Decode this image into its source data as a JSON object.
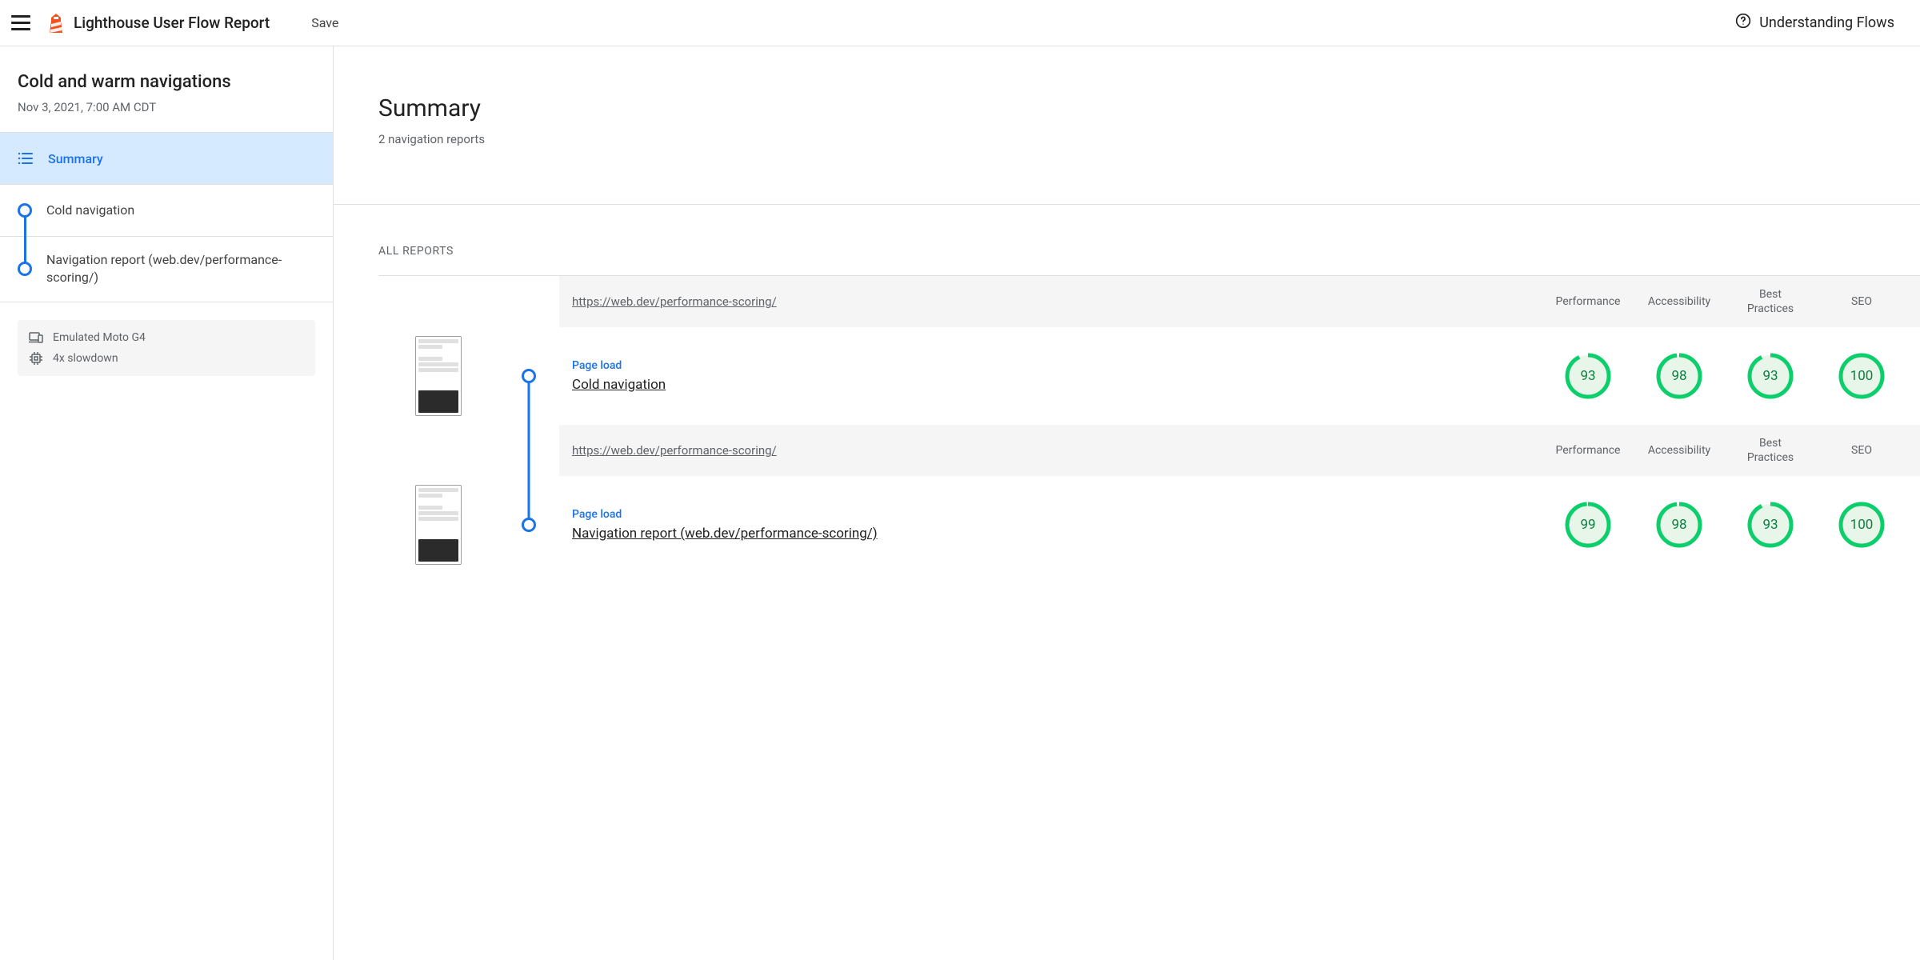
{
  "topbar": {
    "app_title": "Lighthouse User Flow Report",
    "save_label": "Save",
    "help_label": "Understanding Flows"
  },
  "sidebar": {
    "flow_title": "Cold and warm navigations",
    "flow_date": "Nov 3, 2021, 7:00 AM CDT",
    "summary_label": "Summary",
    "steps": [
      {
        "label": "Cold navigation"
      },
      {
        "label": "Navigation report (web.dev/performance-scoring/)"
      }
    ],
    "env": {
      "device": "Emulated Moto G4",
      "cpu": "4x slowdown"
    }
  },
  "main": {
    "title": "Summary",
    "subtitle": "2 navigation reports",
    "all_reports_label": "ALL REPORTS",
    "columns": [
      "Performance",
      "Accessibility",
      "Best Practices",
      "SEO"
    ],
    "reports": [
      {
        "url": "https://web.dev/performance-scoring/",
        "type_label": "Page load",
        "name": "Cold navigation",
        "scores": [
          93,
          98,
          93,
          100
        ]
      },
      {
        "url": "https://web.dev/performance-scoring/",
        "type_label": "Page load",
        "name": "Navigation report (web.dev/performance-scoring/)",
        "scores": [
          99,
          98,
          93,
          100
        ]
      }
    ]
  },
  "colors": {
    "accent": "#1a73e8",
    "pass": "#0cce6b",
    "pass_text": "#0a8042",
    "pass_fill": "#e8f5e9"
  },
  "chart_data": {
    "type": "table",
    "title": "Lighthouse User Flow Summary Scores",
    "columns": [
      "Report",
      "Performance",
      "Accessibility",
      "Best Practices",
      "SEO"
    ],
    "rows": [
      [
        "Cold navigation",
        93,
        98,
        93,
        100
      ],
      [
        "Navigation report (web.dev/performance-scoring/)",
        99,
        98,
        93,
        100
      ]
    ],
    "score_range": [
      0,
      100
    ],
    "gauge_color_pass": "#0cce6b"
  }
}
